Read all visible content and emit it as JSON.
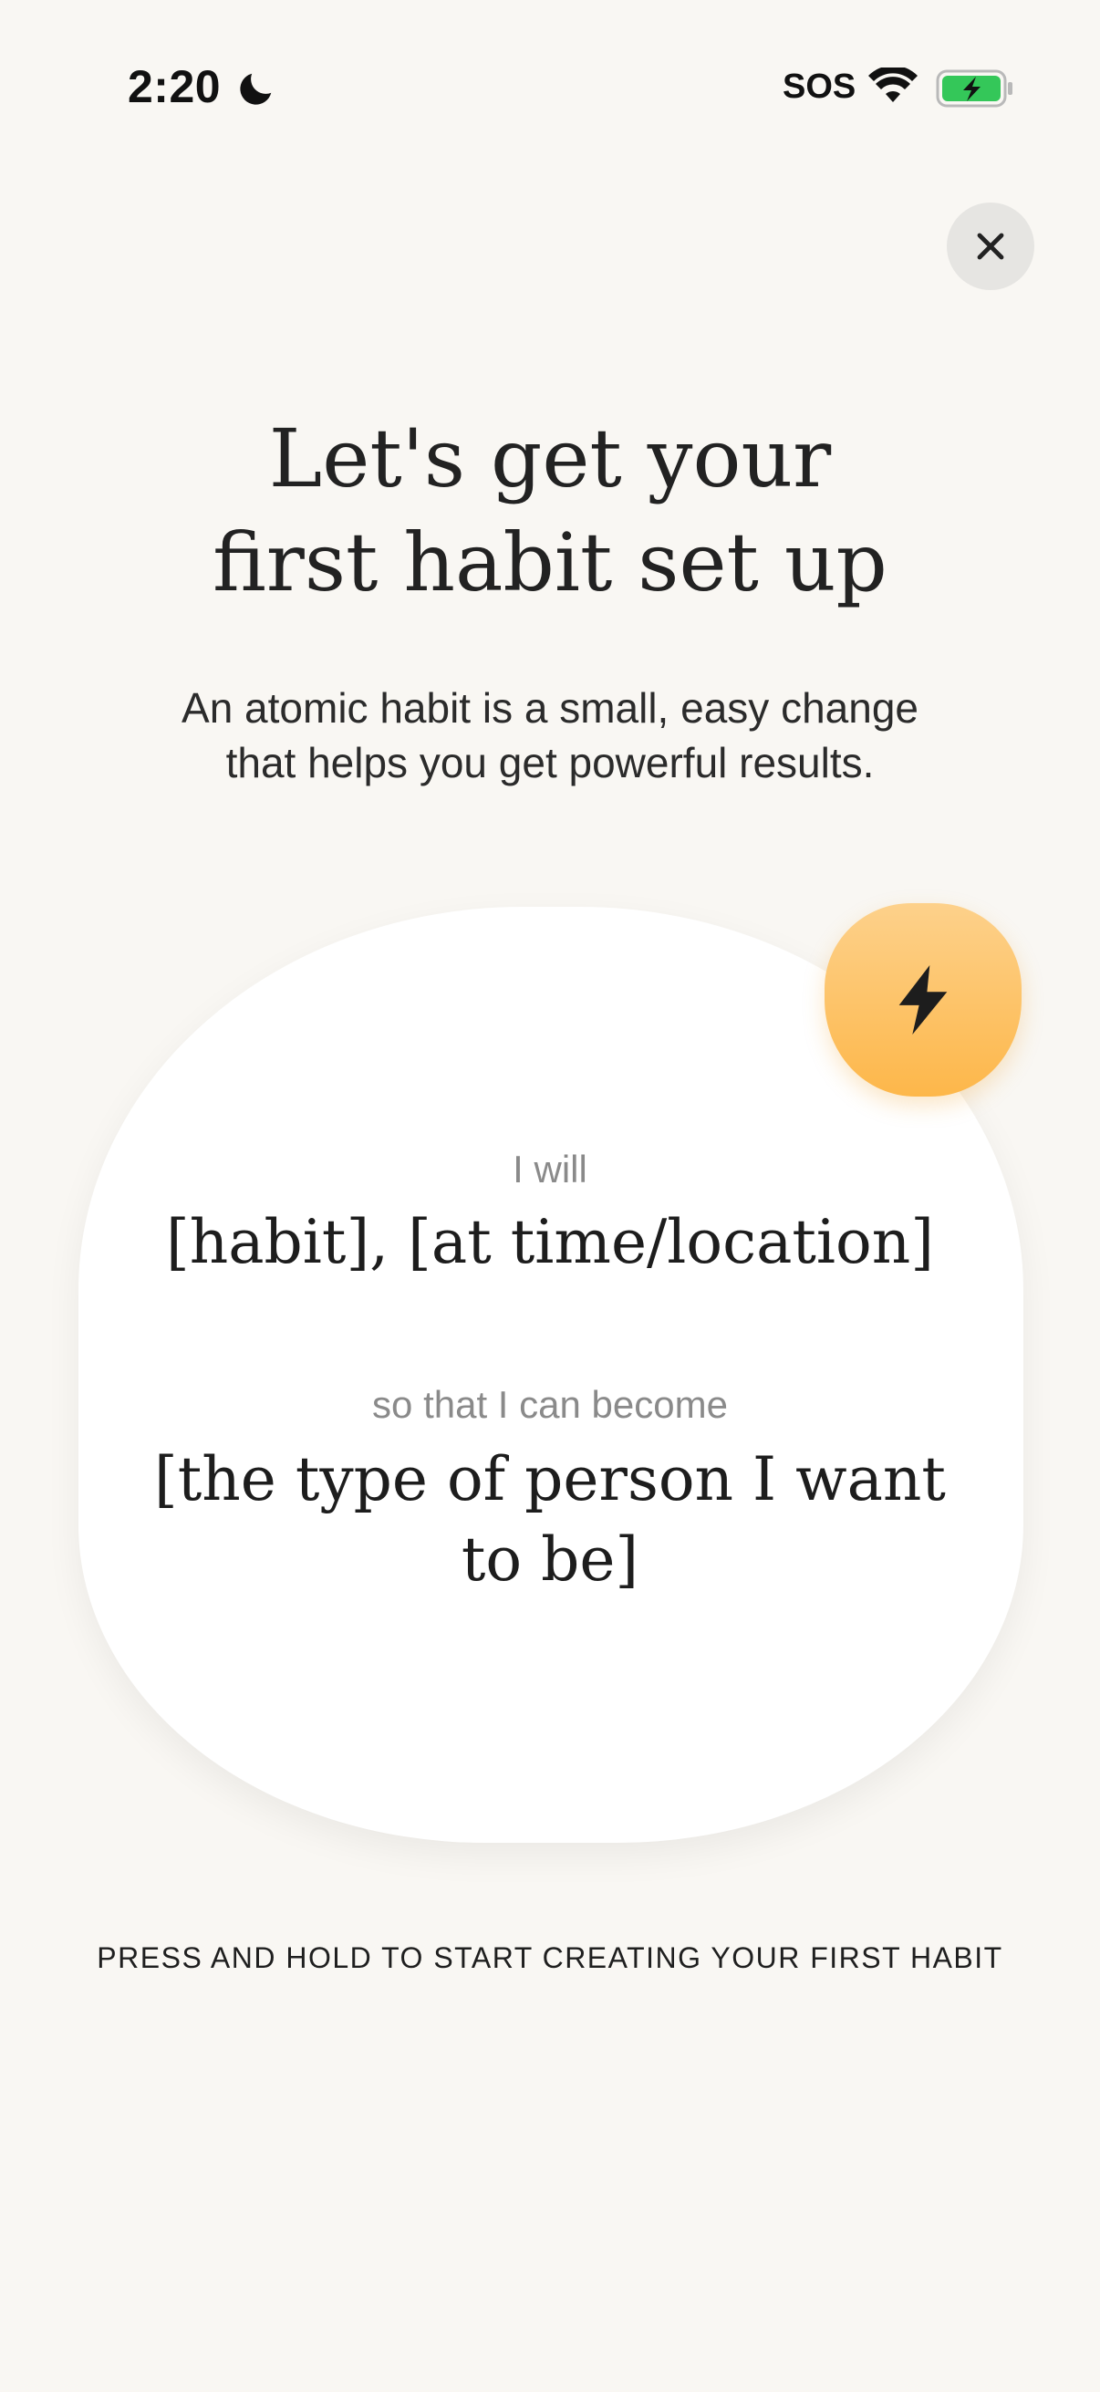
{
  "status_bar": {
    "time": "2:20",
    "carrier": "SOS",
    "icons": [
      "moon-icon",
      "wifi-icon",
      "battery-charging-icon"
    ]
  },
  "close": {
    "icon": "close-icon"
  },
  "header": {
    "title_line1": "Let's get your",
    "title_line2": "first habit set up",
    "subtitle_line1": "An atomic habit is a small, easy change",
    "subtitle_line2": "that helps you get powerful results."
  },
  "card": {
    "label_will": "I will",
    "habit_placeholder": "[habit], [at time/location]",
    "label_become": "so that I can become",
    "identity_line1": "[the type of person I want",
    "identity_line2": "to be]",
    "badge_icon": "lightning-bolt-icon"
  },
  "hint": "PRESS AND HOLD TO START CREATING YOUR FIRST HABIT",
  "colors": {
    "background": "#f9f7f3",
    "card": "#ffffff",
    "badge_top": "#fdd18b",
    "badge_bottom": "#fdb74a",
    "battery_green": "#34c759",
    "close_bg": "#e6e5e2"
  }
}
